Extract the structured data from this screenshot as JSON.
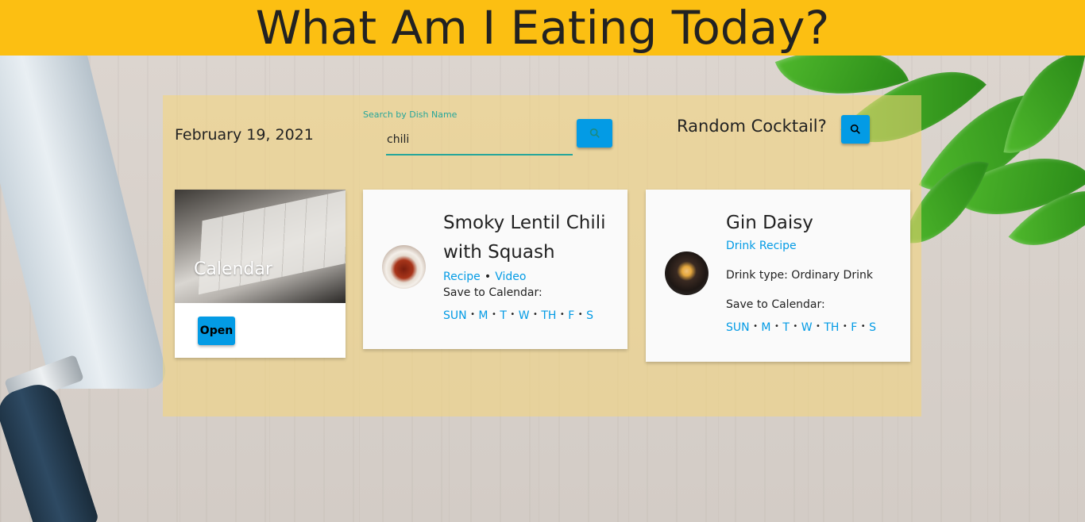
{
  "app": {
    "title": "What Am I Eating Today?"
  },
  "toolbar": {
    "date": "February 19, 2021",
    "search_label": "Search by Dish Name",
    "search_value": "chili",
    "search_icon": "search-icon",
    "cocktail_label": "Random Cocktail?",
    "cocktail_icon": "search-icon"
  },
  "calendar_card": {
    "title": "Calendar",
    "button_label": "Open"
  },
  "recipe_card": {
    "title_line1": "Smoky Lentil Chili",
    "title_line2": "with Squash",
    "recipe_link": "Recipe",
    "video_link": "Video",
    "bullet": "•",
    "save_label": "Save to Calendar:",
    "days": [
      "SUN",
      "M",
      "T",
      "W",
      "TH",
      "F",
      "S"
    ]
  },
  "drink_card": {
    "title": "Gin Daisy",
    "recipe_link": "Drink Recipe",
    "drink_type": "Drink type: Ordinary Drink",
    "save_label": "Save to Calendar:",
    "days": [
      "SUN",
      "M",
      "T",
      "W",
      "TH",
      "F",
      "S"
    ]
  },
  "colors": {
    "header": "#fcbf12",
    "accent": "#039be5",
    "search_underline": "#26a69a"
  }
}
